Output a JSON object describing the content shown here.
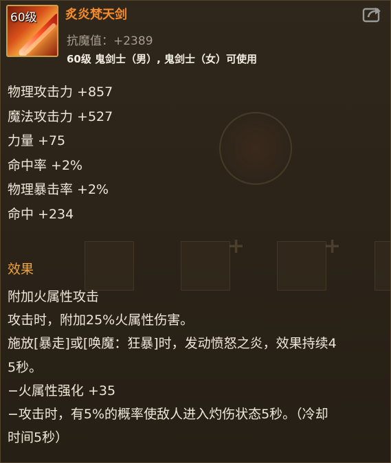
{
  "item": {
    "level_badge": "60级",
    "name": "炙炎梵天剑",
    "magic_resistance": "抗魔值：+2389",
    "class_requirement": "60级 鬼剑士（男）, 鬼剑士（女）可使用",
    "icon": "flame-sword-icon"
  },
  "stats": [
    "物理攻击力 +857",
    "魔法攻击力 +527",
    "力量 +75",
    "命中率 +2%",
    "物理暴击率 +2%",
    "命中 +234"
  ],
  "effect_section": {
    "title": "效果",
    "lines": [
      "附加火属性攻击",
      "攻击时，附加25%火属性伤害。",
      "施放[暴走]或[唤魔：狂暴]时，发动愤怒之炎，效果持续4",
      "5秒。",
      "−火属性强化 +35",
      "−攻击时，有5%的概率使敌人进入灼伤状态5秒。（冷却",
      "时间5秒）"
    ]
  },
  "colors": {
    "name": "#f58b2a",
    "effect_title": "#f2a43a",
    "muted_text": "#a79e8e",
    "body_text": "#efe7d8",
    "background": "#2c2418"
  },
  "share_button": {
    "icon": "share-icon"
  }
}
